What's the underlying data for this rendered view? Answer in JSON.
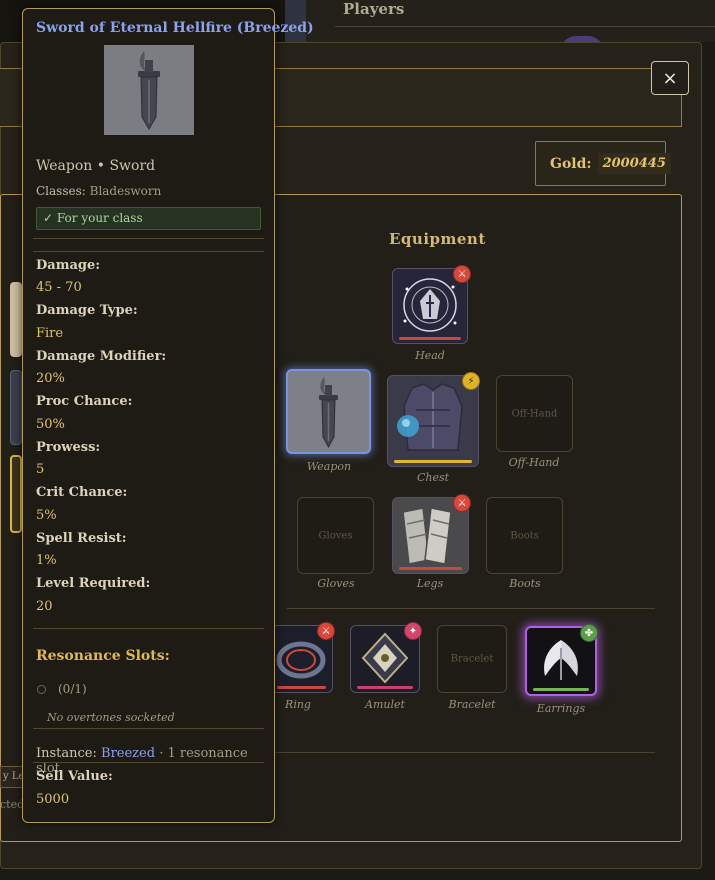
{
  "background": {
    "players_title": "Players",
    "left_tab_text": "y Lef",
    "left_bottom_text": "cted"
  },
  "modal": {
    "close_label": "×",
    "gold_label": "Gold:",
    "gold_value": "2000445",
    "equipment_title": "Equipment"
  },
  "slots": {
    "head": {
      "caption": "Head",
      "badge": "⚔"
    },
    "weapon": {
      "caption": "Weapon"
    },
    "chest": {
      "caption": "Chest",
      "badge": "⚡"
    },
    "offhand": {
      "caption": "Off-Hand",
      "placeholder": "Off-Hand"
    },
    "gloves": {
      "caption": "Gloves",
      "placeholder": "Gloves"
    },
    "legs": {
      "caption": "Legs",
      "badge": "⚔"
    },
    "boots": {
      "caption": "Boots",
      "placeholder": "Boots"
    },
    "ring": {
      "caption": "Ring",
      "badge": "⚔"
    },
    "amulet": {
      "caption": "Amulet",
      "badge": "✦"
    },
    "bracelet": {
      "caption": "Bracelet",
      "placeholder": "Bracelet"
    },
    "earrings": {
      "caption": "Earrings",
      "badge": "✤"
    }
  },
  "tooltip": {
    "title": "Sword of Eternal Hellfire (Breezed)",
    "type_line": "Weapon • Sword",
    "classes_label": "Classes:",
    "classes_value": "Bladesworn",
    "class_ok": "✓ For your class",
    "stats": [
      {
        "label": "Damage:",
        "value": "45 - 70"
      },
      {
        "label": "Damage Type:",
        "value": "Fire"
      },
      {
        "label": "Damage Modifier:",
        "value": "20%"
      },
      {
        "label": "Proc Chance:",
        "value": "50%"
      },
      {
        "label": "Prowess:",
        "value": "5"
      },
      {
        "label": "Crit Chance:",
        "value": "5%"
      },
      {
        "label": "Spell Resist:",
        "value": "1%"
      },
      {
        "label": "Level Required:",
        "value": "20"
      }
    ],
    "resonance_title": "Resonance Slots:",
    "resonance_slot": "(0/1)",
    "no_overtones": "No overtones socketed",
    "instance_label": "Instance:",
    "instance_name": "Breezed",
    "instance_extra": "· 1 resonance slot",
    "sell_label": "Sell Value:",
    "sell_value": "5000"
  },
  "colors": {
    "accent_gold": "#e3c271",
    "frame_gold": "#b49b55",
    "item_name_blue": "#8aa2f0",
    "durability_red": "#c94a3d",
    "durability_yellow": "#e1b72d",
    "durability_green": "#7ab352",
    "durability_pink": "#c9406a"
  }
}
